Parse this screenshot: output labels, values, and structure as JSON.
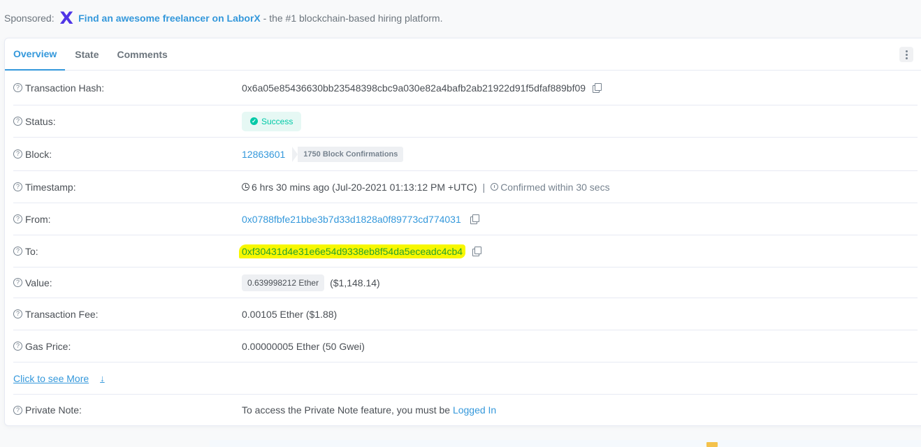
{
  "sponsor": {
    "prefix": "Sponsored:",
    "logo": "X",
    "link_text": "Find an awesome freelancer on LaborX",
    "suffix": " - the #1 blockchain-based hiring platform."
  },
  "tabs": [
    {
      "label": "Overview",
      "active": true
    },
    {
      "label": "State",
      "active": false
    },
    {
      "label": "Comments",
      "active": false
    }
  ],
  "rows": {
    "tx_hash": {
      "label": "Transaction Hash:",
      "value": "0x6a05e85436630bb23548398cbc9a030e82a4bafb2ab21922d91f5dfaf889bf09"
    },
    "status": {
      "label": "Status:",
      "value": "Success"
    },
    "block": {
      "label": "Block:",
      "value": "12863601",
      "confirmations": "1750 Block Confirmations"
    },
    "timestamp": {
      "label": "Timestamp:",
      "value": "6 hrs 30 mins ago (Jul-20-2021 01:13:12 PM +UTC)",
      "separator": "|",
      "confirmed": "Confirmed within 30 secs"
    },
    "from": {
      "label": "From:",
      "value": "0x0788fbfe21bbe3b7d33d1828a0f89773cd774031"
    },
    "to": {
      "label": "To:",
      "value": "0xf30431d4e31e6e54d9338eb8f54da5eceadc4cb4"
    },
    "value": {
      "label": "Value:",
      "ether": "0.639998212 Ether",
      "usd": "($1,148.14)"
    },
    "fee": {
      "label": "Transaction Fee:",
      "value": "0.00105 Ether ($1.88)"
    },
    "gas": {
      "label": "Gas Price:",
      "value": "0.00000005 Ether (50 Gwei)"
    },
    "see_more": {
      "label": "Click to see More",
      "arrow": "↓"
    },
    "private_note": {
      "label": "Private Note:",
      "text": "To access the Private Note feature, you must be ",
      "link": "Logged In"
    }
  },
  "icons": {
    "question": "?",
    "check": "✓"
  },
  "colors": {
    "accent": "#3498db",
    "success": "#00c9a7",
    "highlight": "#f7f700",
    "laborx": "#4f35e6"
  }
}
